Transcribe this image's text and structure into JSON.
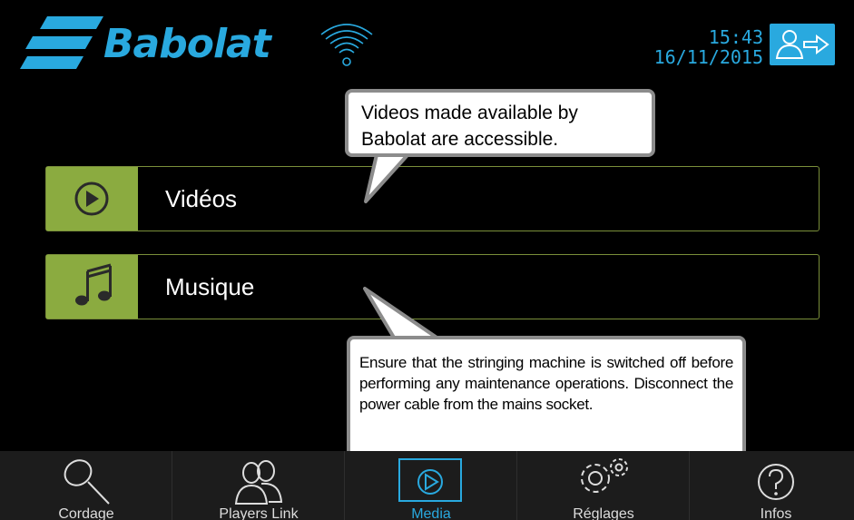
{
  "header": {
    "logo_text": "Babolat",
    "time": "15:43",
    "date": "16/11/2015"
  },
  "menu": {
    "items": [
      {
        "label": "Vidéos",
        "icon": "play-circle-icon"
      },
      {
        "label": "Musique",
        "icon": "music-note-icon"
      }
    ]
  },
  "callouts": {
    "videos": "Videos made available by Babolat are accessible.",
    "maintenance": "Ensure that the stringing machine is switched off before performing any maintenance operations. Disconnect the power cable from the mains socket."
  },
  "nav": {
    "items": [
      {
        "label": "Cordage",
        "icon": "racket-icon"
      },
      {
        "label": "Players Link",
        "icon": "players-icon"
      },
      {
        "label": "Media",
        "icon": "media-play-icon"
      },
      {
        "label": "Réglages",
        "icon": "gears-icon"
      },
      {
        "label": "Infos",
        "icon": "question-icon"
      }
    ],
    "active_index": 2
  },
  "colors": {
    "accent_blue": "#29a9df",
    "accent_green": "#8bab40",
    "background": "#000000"
  }
}
